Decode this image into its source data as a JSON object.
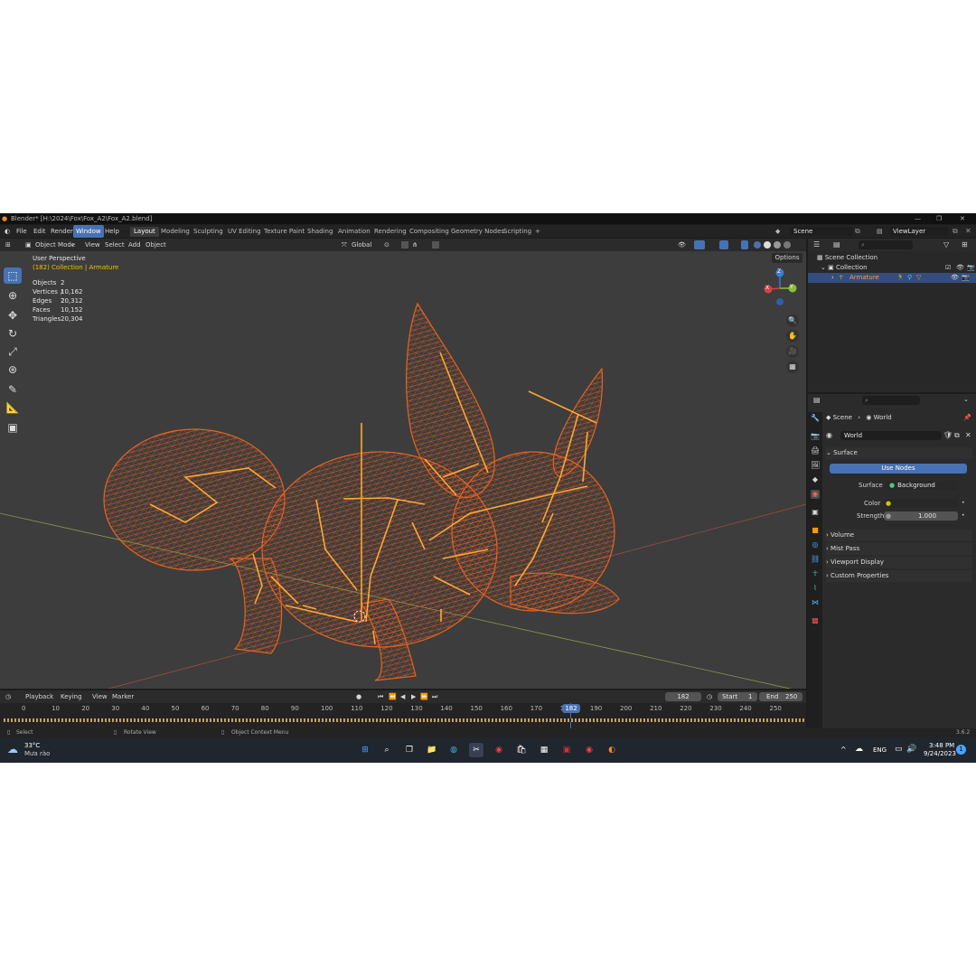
{
  "window": {
    "title": "Blender* [H:\\2024\\Fox\\Fox_A2\\Fox_A2.blend]",
    "controls": [
      "—",
      "❐",
      "✕"
    ]
  },
  "menu": [
    "File",
    "Edit",
    "Render",
    "Window",
    "Help"
  ],
  "active_menu": "Window",
  "workspaces": [
    "Layout",
    "Modeling",
    "Sculpting",
    "UV Editing",
    "Texture Paint",
    "Shading",
    "Animation",
    "Rendering",
    "Compositing",
    "Geometry Nodes",
    "Scripting"
  ],
  "active_workspace": "Layout",
  "scene_field": "Scene",
  "viewlayer_field": "ViewLayer",
  "viewport_header": {
    "mode": "Object Mode",
    "menus": [
      "View",
      "Select",
      "Add",
      "Object"
    ],
    "transform": "Global",
    "options": "Options"
  },
  "viewport": {
    "perspective": "User Perspective",
    "collection_info": "(182) Collection | Armature",
    "stats": [
      {
        "label": "Objects",
        "value": "2 / 2"
      },
      {
        "label": "Vertices",
        "value": "10,162"
      },
      {
        "label": "Edges",
        "value": "20,312"
      },
      {
        "label": "Faces",
        "value": "10,152"
      },
      {
        "label": "Triangles",
        "value": "20,304"
      }
    ],
    "gizmo": {
      "x": "X",
      "y": "Y",
      "z": "Z"
    }
  },
  "outliner": {
    "scene_collection": "Scene Collection",
    "collection": "Collection",
    "armature": "Armature"
  },
  "properties": {
    "breadcrumb": [
      "Scene",
      "World"
    ],
    "world_name": "World",
    "surface_header": "Surface",
    "use_nodes": "Use Nodes",
    "surface_label": "Surface",
    "surface_value": "Background",
    "color_label": "Color",
    "strength_label": "Strength",
    "strength_value": "1.000",
    "collapsed_panels": [
      "Volume",
      "Mist Pass",
      "Viewport Display",
      "Custom Properties"
    ]
  },
  "timeline": {
    "menus": [
      "Playback",
      "Keying",
      "View",
      "Marker"
    ],
    "current_frame": "182",
    "start_label": "Start",
    "start_value": "1",
    "end_label": "End",
    "end_value": "250",
    "ticks": [
      "0",
      "10",
      "20",
      "30",
      "40",
      "50",
      "60",
      "70",
      "80",
      "90",
      "100",
      "110",
      "120",
      "130",
      "140",
      "150",
      "160",
      "170",
      "180",
      "190",
      "200",
      "210",
      "220",
      "230",
      "240",
      "250"
    ],
    "playhead": "182"
  },
  "statusbar": {
    "select": "Select",
    "rotate": "Rotate View",
    "context": "Object Context Menu",
    "version": "3.6.2"
  },
  "taskbar": {
    "temp": "33°C",
    "weather": "Mưa rào",
    "lang": "ENG",
    "time": "3:48 PM",
    "date": "9/24/2023",
    "notif": "1"
  },
  "colors": {
    "accent": "#4772b3",
    "mesh": "#e05a1c",
    "bones": "#ffa733",
    "viewport_bg": "#3d3d3d"
  }
}
